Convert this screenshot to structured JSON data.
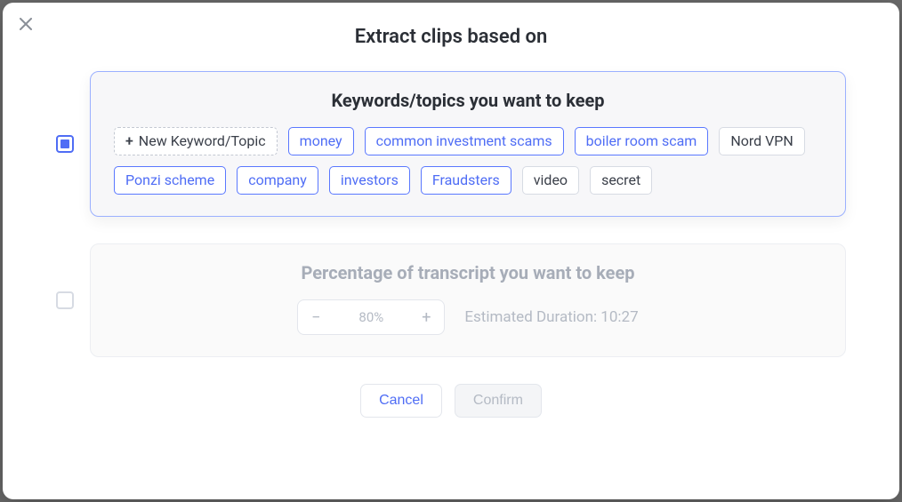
{
  "modal": {
    "title": "Extract clips based on"
  },
  "sections": {
    "keywords": {
      "checked": true,
      "title": "Keywords/topics you want to keep",
      "add_label": "New Keyword/Topic",
      "tags": [
        {
          "label": "money",
          "variant": "blue"
        },
        {
          "label": "common investment scams",
          "variant": "blue"
        },
        {
          "label": "boiler room scam",
          "variant": "blue"
        },
        {
          "label": "Nord VPN",
          "variant": "gray"
        },
        {
          "label": "Ponzi scheme",
          "variant": "blue"
        },
        {
          "label": "company",
          "variant": "blue"
        },
        {
          "label": "investors",
          "variant": "blue"
        },
        {
          "label": "Fraudsters",
          "variant": "blue"
        },
        {
          "label": "video",
          "variant": "gray"
        },
        {
          "label": "secret",
          "variant": "gray"
        }
      ]
    },
    "percentage": {
      "checked": false,
      "title": "Percentage of transcript you want to keep",
      "value": "80%",
      "duration_label": "Estimated Duration: 10:27"
    }
  },
  "footer": {
    "cancel": "Cancel",
    "confirm": "Confirm"
  }
}
